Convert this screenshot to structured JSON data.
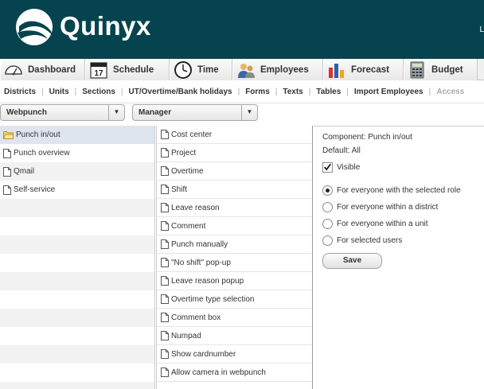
{
  "header": {
    "logo_text": "Quinyx",
    "right_text": "L"
  },
  "topnav": {
    "tabs": [
      {
        "label": "Dashboard",
        "icon": "dashboard-gauge-icon"
      },
      {
        "label": "Schedule",
        "icon": "calendar-icon",
        "calendar_day": "17"
      },
      {
        "label": "Time",
        "icon": "clock-icon"
      },
      {
        "label": "Employees",
        "icon": "people-icon"
      },
      {
        "label": "Forecast",
        "icon": "bar-chart-icon"
      },
      {
        "label": "Budget",
        "icon": "calculator-icon"
      }
    ]
  },
  "subnav": {
    "items": [
      "Districts",
      "Units",
      "Sections",
      "UT/Overtime/Bank holidays",
      "Forms",
      "Texts",
      "Tables",
      "Import Employees",
      "Access"
    ]
  },
  "filters": {
    "module": "Webpunch",
    "role": "Manager"
  },
  "left_list": {
    "items": [
      "Punch in/out",
      "Punch overview",
      "Qmail",
      "Self-service"
    ],
    "selected": "Punch in/out"
  },
  "mid_list": {
    "items": [
      "Cost center",
      "Project",
      "Overtime",
      "Shift",
      "Leave reason",
      "Comment",
      "Punch manually",
      "\"No shift\" pop-up",
      "Leave reason popup",
      "Overtime type selection",
      "Comment box",
      "Numpad",
      "Show cardnumber",
      "Allow camera in webpunch"
    ]
  },
  "panel": {
    "component": "Component: Punch in/out",
    "default": "Default: All",
    "visible_label": "Visible",
    "visible_checked": true,
    "options": [
      "For everyone with the selected role",
      "For everyone within a district",
      "For everyone within a unit",
      "For selected users"
    ],
    "selected_option": 0,
    "save_label": "Save"
  },
  "colors": {
    "header_bg": "#05444e",
    "selected_row": "#dfe5ef"
  }
}
